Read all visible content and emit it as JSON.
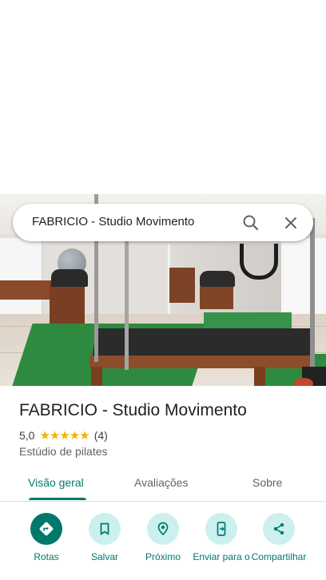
{
  "search": {
    "query": "FABRICIO - Studio Movimento"
  },
  "place": {
    "name": "FABRICIO - Studio Movimento",
    "rating": "5,0",
    "stars": "★★★★★",
    "review_count": "(4)",
    "category": "Estúdio de pilates"
  },
  "tabs": [
    {
      "label": "Visão geral",
      "active": true
    },
    {
      "label": "Avaliações",
      "active": false
    },
    {
      "label": "Sobre",
      "active": false
    }
  ],
  "actions": [
    {
      "label": "Rotas",
      "icon": "directions-icon"
    },
    {
      "label": "Salvar",
      "icon": "bookmark-icon"
    },
    {
      "label": "Próximo",
      "icon": "nearby-icon"
    },
    {
      "label": "Enviar para o",
      "icon": "send-to-phone-icon"
    },
    {
      "label": "Compartilhar",
      "icon": "share-icon"
    }
  ],
  "colors": {
    "accent": "#00796b",
    "accent_light": "#ccf0ee",
    "star": "#f4b400"
  }
}
